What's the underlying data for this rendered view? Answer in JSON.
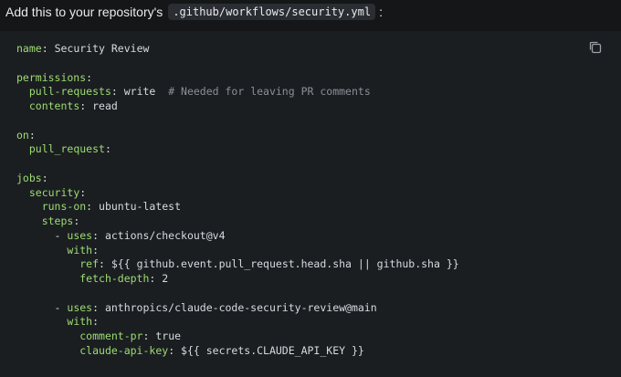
{
  "intro": {
    "text": "Add this to your repository's",
    "path": ".github/workflows/security.yml",
    "suffix": ":"
  },
  "code": {
    "language": "yaml",
    "lines": [
      [
        {
          "t": "name",
          "k": 1
        },
        {
          "t": ": "
        },
        {
          "t": "Security Review"
        }
      ],
      [],
      [
        {
          "t": "permissions",
          "k": 1
        },
        {
          "t": ":"
        }
      ],
      [
        {
          "t": "  "
        },
        {
          "t": "pull-requests",
          "k": 1
        },
        {
          "t": ": write  "
        },
        {
          "t": "# Needed for leaving PR comments",
          "c": 1
        }
      ],
      [
        {
          "t": "  "
        },
        {
          "t": "contents",
          "k": 1
        },
        {
          "t": ": read"
        }
      ],
      [],
      [
        {
          "t": "on",
          "k": 1
        },
        {
          "t": ":"
        }
      ],
      [
        {
          "t": "  "
        },
        {
          "t": "pull_request",
          "k": 1
        },
        {
          "t": ":"
        }
      ],
      [],
      [
        {
          "t": "jobs",
          "k": 1
        },
        {
          "t": ":"
        }
      ],
      [
        {
          "t": "  "
        },
        {
          "t": "security",
          "k": 1
        },
        {
          "t": ":"
        }
      ],
      [
        {
          "t": "    "
        },
        {
          "t": "runs-on",
          "k": 1
        },
        {
          "t": ": ubuntu-latest"
        }
      ],
      [
        {
          "t": "    "
        },
        {
          "t": "steps",
          "k": 1
        },
        {
          "t": ":"
        }
      ],
      [
        {
          "t": "      - "
        },
        {
          "t": "uses",
          "k": 1
        },
        {
          "t": ": actions/checkout@v4"
        }
      ],
      [
        {
          "t": "        "
        },
        {
          "t": "with",
          "k": 1
        },
        {
          "t": ":"
        }
      ],
      [
        {
          "t": "          "
        },
        {
          "t": "ref",
          "k": 1
        },
        {
          "t": ": ${{ github.event.pull_request.head.sha || github.sha }}"
        }
      ],
      [
        {
          "t": "          "
        },
        {
          "t": "fetch-depth",
          "k": 1
        },
        {
          "t": ": 2"
        }
      ],
      [],
      [
        {
          "t": "      - "
        },
        {
          "t": "uses",
          "k": 1
        },
        {
          "t": ": anthropics/claude-code-security-review@main"
        }
      ],
      [
        {
          "t": "        "
        },
        {
          "t": "with",
          "k": 1
        },
        {
          "t": ":"
        }
      ],
      [
        {
          "t": "          "
        },
        {
          "t": "comment-pr",
          "k": 1
        },
        {
          "t": ": true"
        }
      ],
      [
        {
          "t": "          "
        },
        {
          "t": "claude-api-key",
          "k": 1
        },
        {
          "t": ": ${{ secrets.CLAUDE_API_KEY }}"
        }
      ]
    ]
  },
  "copy_button": {
    "icon": "copy-icon",
    "color": "#9aa0a6"
  },
  "colors": {
    "background": "#141618",
    "code_background": "#1b1e21",
    "key": "#9ddc72",
    "text": "#d7dadf",
    "comment": "#8b9097"
  }
}
